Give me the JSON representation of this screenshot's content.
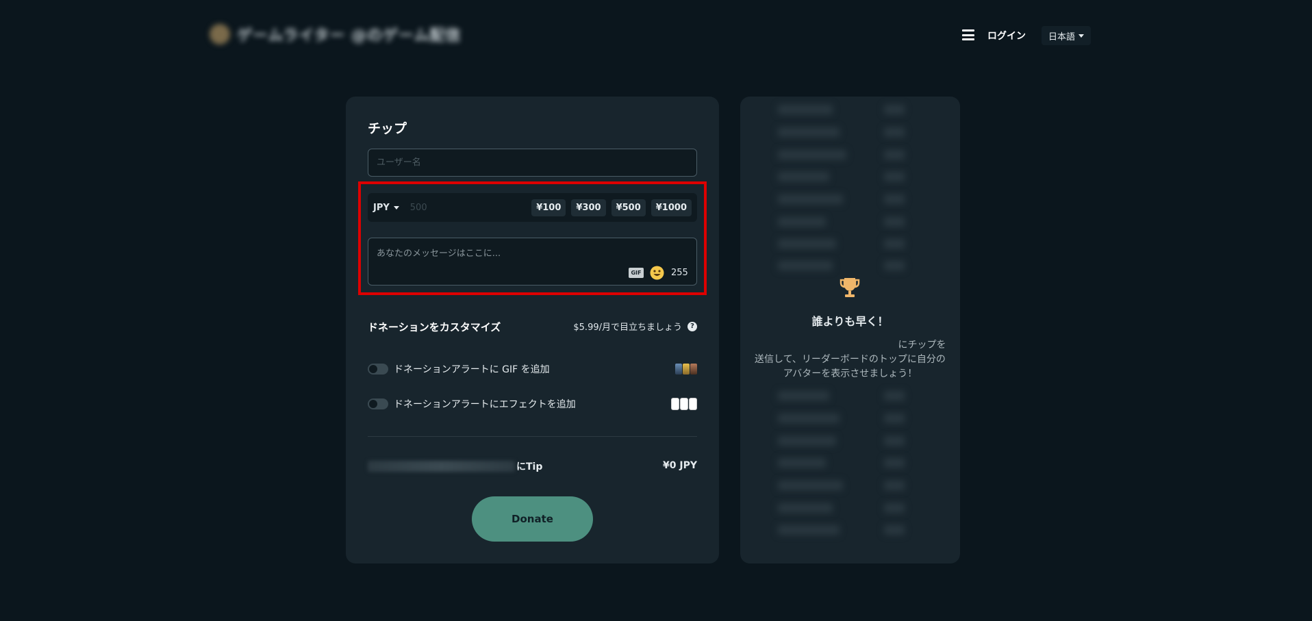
{
  "header": {
    "brand_name": "ゲームライター @のゲーム配信",
    "login_label": "ログイン",
    "language_label": "日本語"
  },
  "tip_form": {
    "title": "チップ",
    "username_placeholder": "ユーザー名",
    "currency": "JPY",
    "amount_placeholder": "500",
    "presets": [
      "¥100",
      "¥300",
      "¥500",
      "¥1000"
    ],
    "message_placeholder": "あなたのメッセージはここに...",
    "gif_label": "GIF",
    "char_count": "255",
    "customize_title": "ドネーションをカスタマイズ",
    "promo_text": "$5.99/月で目立ちましょう",
    "help_symbol": "?",
    "gif_toggle_label": "ドネーションアラートに GIF を追加",
    "effect_toggle_label": "ドネーションアラートにエフェクトを追加",
    "tip_target_suffix": "にTip",
    "total": "¥0 JPY",
    "donate_label": "Donate"
  },
  "leaderboard": {
    "title": "誰よりも早く！",
    "text_line1_suffix": "にチップを",
    "text_line2": "送信して、リーダーボードのトップに自分の",
    "text_line3": "アバターを表示させましょう！"
  },
  "colors": {
    "background": "#0b161d",
    "card": "#18252d",
    "accent": "#4d9080",
    "highlight": "#dd0000",
    "trophy": "#f0b66a"
  }
}
